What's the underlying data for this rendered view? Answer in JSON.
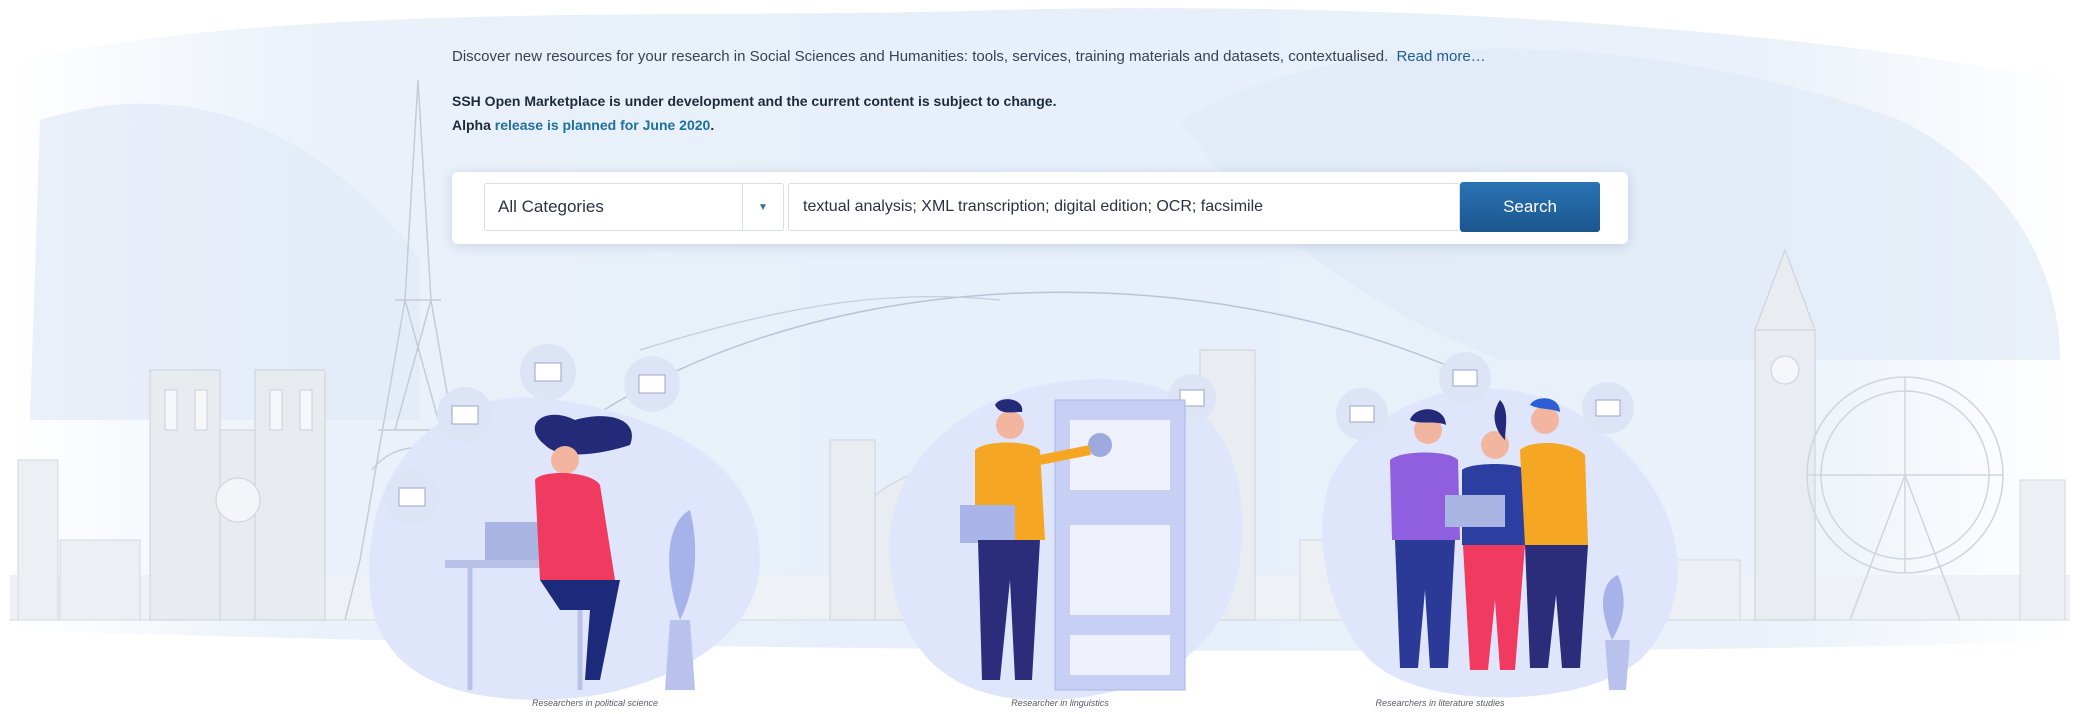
{
  "intro": {
    "text": "Discover new resources for your research in Social Sciences and Humanities: tools, services, training materials and datasets, contextualised.",
    "read_more": "Read more…"
  },
  "notice": {
    "line1": "SSH Open Marketplace is under development and the current content is subject to change.",
    "line2_prefix": "Alpha",
    "line2_link": "release is planned for June 2020",
    "line2_suffix": "."
  },
  "search": {
    "category_value": "All Categories",
    "query_value": "textual analysis; XML transcription; digital edition; OCR; facsimile",
    "button_label": "Search"
  },
  "illustrations": [
    {
      "caption": "Researchers in political science"
    },
    {
      "caption": "Researcher in linguistics"
    },
    {
      "caption": "Researchers in literature studies"
    }
  ],
  "colors": {
    "accent": "#1f6fa0",
    "button": "#2366a5",
    "background_wash": "#e6effa",
    "illustration_blob": "#dfe6fb"
  },
  "icons": {
    "dropdown": "caret-down-icon",
    "profile_cards": "profile-card-icon"
  }
}
